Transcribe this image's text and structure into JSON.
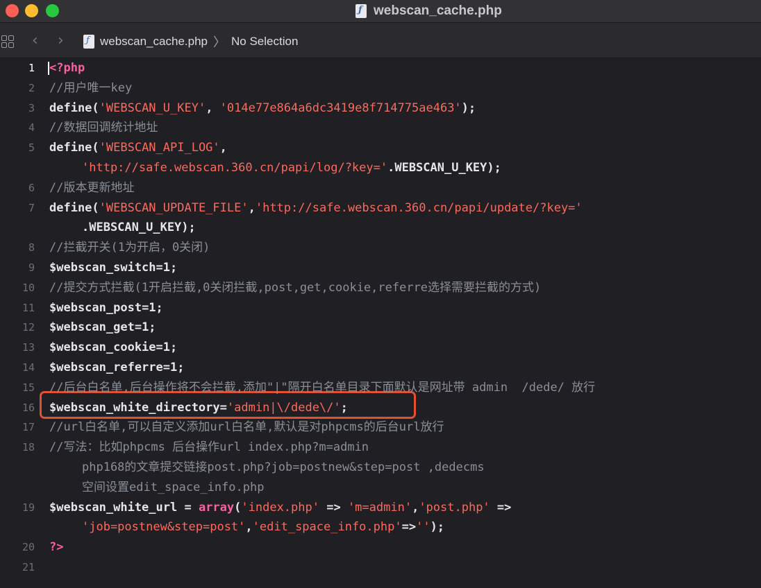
{
  "window": {
    "title": "webscan_cache.php"
  },
  "jumpbar": {
    "file": "webscan_cache.php",
    "selection": "No Selection"
  },
  "editor": {
    "current_line": 1,
    "highlighted_line": 16,
    "lines": [
      {
        "n": "1",
        "t": "<?php",
        "kind": "kw"
      },
      {
        "n": "2",
        "t": "//用户唯一key",
        "kind": "cmt"
      },
      {
        "n": "3",
        "segs": [
          [
            "define(",
            "plain"
          ],
          [
            "'WEBSCAN_U_KEY'",
            "str"
          ],
          [
            ", ",
            "plain"
          ],
          [
            "'014e77e864a6dc3419e8f714775ae463'",
            "str"
          ],
          [
            ");",
            "plain"
          ]
        ]
      },
      {
        "n": "4",
        "t": "//数据回调统计地址",
        "kind": "cmt"
      },
      {
        "n": "5",
        "segs": [
          [
            "define(",
            "plain"
          ],
          [
            "'WEBSCAN_API_LOG'",
            "str"
          ],
          [
            ",",
            "plain"
          ]
        ]
      },
      {
        "n": "",
        "cont": true,
        "segs": [
          [
            "'http://safe.webscan.360.cn/papi/log/?key='",
            "str"
          ],
          [
            ".WEBSCAN_U_KEY);",
            "plain"
          ]
        ]
      },
      {
        "n": "6",
        "t": "//版本更新地址",
        "kind": "cmt"
      },
      {
        "n": "7",
        "segs": [
          [
            "define(",
            "plain"
          ],
          [
            "'WEBSCAN_UPDATE_FILE'",
            "str"
          ],
          [
            ",",
            "plain"
          ],
          [
            "'http://safe.webscan.360.cn/papi/update/?key='",
            "str"
          ]
        ]
      },
      {
        "n": "",
        "cont": true,
        "segs": [
          [
            ".WEBSCAN_U_KEY);",
            "plain"
          ]
        ]
      },
      {
        "n": "8",
        "t": "//拦截开关(1为开启，0关闭)",
        "kind": "cmt"
      },
      {
        "n": "9",
        "segs": [
          [
            "$webscan_switch",
            "var"
          ],
          [
            "=1;",
            "plain"
          ]
        ]
      },
      {
        "n": "10",
        "t": "//提交方式拦截(1开启拦截,0关闭拦截,post,get,cookie,referre选择需要拦截的方式)",
        "kind": "cmt"
      },
      {
        "n": "11",
        "segs": [
          [
            "$webscan_post",
            "var"
          ],
          [
            "=1;",
            "plain"
          ]
        ]
      },
      {
        "n": "12",
        "segs": [
          [
            "$webscan_get",
            "var"
          ],
          [
            "=1;",
            "plain"
          ]
        ]
      },
      {
        "n": "13",
        "segs": [
          [
            "$webscan_cookie",
            "var"
          ],
          [
            "=1;",
            "plain"
          ]
        ]
      },
      {
        "n": "14",
        "segs": [
          [
            "$webscan_referre",
            "var"
          ],
          [
            "=1;",
            "plain"
          ]
        ]
      },
      {
        "n": "15",
        "t": "//后台白名单,后台操作将不会拦截,添加\"|\"隔开白名单目录下面默认是网址带 admin  /dede/ 放行",
        "kind": "cmt"
      },
      {
        "n": "16",
        "segs": [
          [
            "$webscan_white_directory",
            "var"
          ],
          [
            "=",
            "plain"
          ],
          [
            "'admin|\\/dede\\/'",
            "str"
          ],
          [
            ";",
            "plain"
          ]
        ]
      },
      {
        "n": "17",
        "t": "//url白名单,可以自定义添加url白名单,默认是对phpcms的后台url放行",
        "kind": "cmt"
      },
      {
        "n": "18",
        "t": "//写法：比如phpcms 后台操作url index.php?m=admin",
        "kind": "cmt"
      },
      {
        "n": "",
        "cont": true,
        "t": "php168的文章提交链接post.php?job=postnew&step=post ,dedecms",
        "kind": "cmt"
      },
      {
        "n": "",
        "cont": true,
        "t": "空间设置edit_space_info.php",
        "kind": "cmt"
      },
      {
        "n": "19",
        "segs": [
          [
            "$webscan_white_url",
            "var"
          ],
          [
            " = ",
            "plain"
          ],
          [
            "array",
            "kw"
          ],
          [
            "(",
            "plain"
          ],
          [
            "'index.php'",
            "str"
          ],
          [
            " => ",
            "plain"
          ],
          [
            "'m=admin'",
            "str"
          ],
          [
            ",",
            "plain"
          ],
          [
            "'post.php'",
            "str"
          ],
          [
            " =>",
            "plain"
          ]
        ]
      },
      {
        "n": "",
        "cont": true,
        "segs": [
          [
            "'job=postnew&step=post'",
            "str"
          ],
          [
            ",",
            "plain"
          ],
          [
            "'edit_space_info.php'",
            "str"
          ],
          [
            "=>",
            "plain"
          ],
          [
            "''",
            "str"
          ],
          [
            ");",
            "plain"
          ]
        ]
      },
      {
        "n": "20",
        "t": "?>",
        "kind": "kw"
      },
      {
        "n": "21",
        "t": "",
        "kind": "plain"
      }
    ]
  },
  "colors": {
    "keyword": "#fc5fa3",
    "string": "#fc6a5d",
    "comment": "#8a8f98",
    "highlight_box": "#e2502f"
  },
  "icons": [
    "grid-icon",
    "chevron-left-icon",
    "chevron-right-icon",
    "php-file-icon"
  ]
}
